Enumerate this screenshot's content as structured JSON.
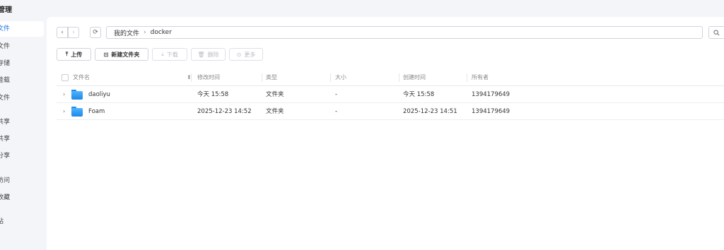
{
  "app": {
    "title": "管理"
  },
  "sidebar": {
    "items": [
      {
        "label": "文件",
        "active": true
      },
      {
        "label": "文件",
        "active": false
      },
      {
        "label": "存储",
        "active": false
      },
      {
        "label": "挂载",
        "active": false
      },
      {
        "label": "文件",
        "active": false
      },
      {
        "label": "共享",
        "active": false
      },
      {
        "label": "共享",
        "active": false
      },
      {
        "label": "分享",
        "active": false
      },
      {
        "label": "访问",
        "active": false
      },
      {
        "label": "收藏",
        "active": false
      },
      {
        "label": "站",
        "active": false
      }
    ]
  },
  "nav": {
    "back": "‹",
    "forward": "›",
    "refresh": "⟳"
  },
  "breadcrumb": {
    "items": [
      "我的文件",
      "docker"
    ],
    "separator": "›"
  },
  "search": {
    "icon": "search-icon"
  },
  "toolbar": {
    "upload": {
      "icon": "⤒",
      "label": "上传"
    },
    "new_folder": {
      "icon": "⊡",
      "label": "新建文件夹"
    },
    "download": {
      "icon": "⤓",
      "label": "下载"
    },
    "delete": {
      "icon": "🗑",
      "label": "删除"
    },
    "more": {
      "icon": "⊙",
      "label": "更多"
    }
  },
  "table": {
    "columns": {
      "name": "文件名",
      "modified": "修改时间",
      "type": "类型",
      "size": "大小",
      "created": "创建时间",
      "owner": "所有者"
    },
    "rows": [
      {
        "name": "daoliyu",
        "modified": "今天 15:58",
        "type": "文件夹",
        "size": "-",
        "created": "今天 15:58",
        "owner": "1394179649"
      },
      {
        "name": "Foam",
        "modified": "2025-12-23 14:52",
        "type": "文件夹",
        "size": "-",
        "created": "2025-12-23 14:51",
        "owner": "1394179649"
      }
    ]
  },
  "colors": {
    "accent": "#1a73e8",
    "folder": "#1e88e5",
    "background": "#f3f5f8"
  }
}
